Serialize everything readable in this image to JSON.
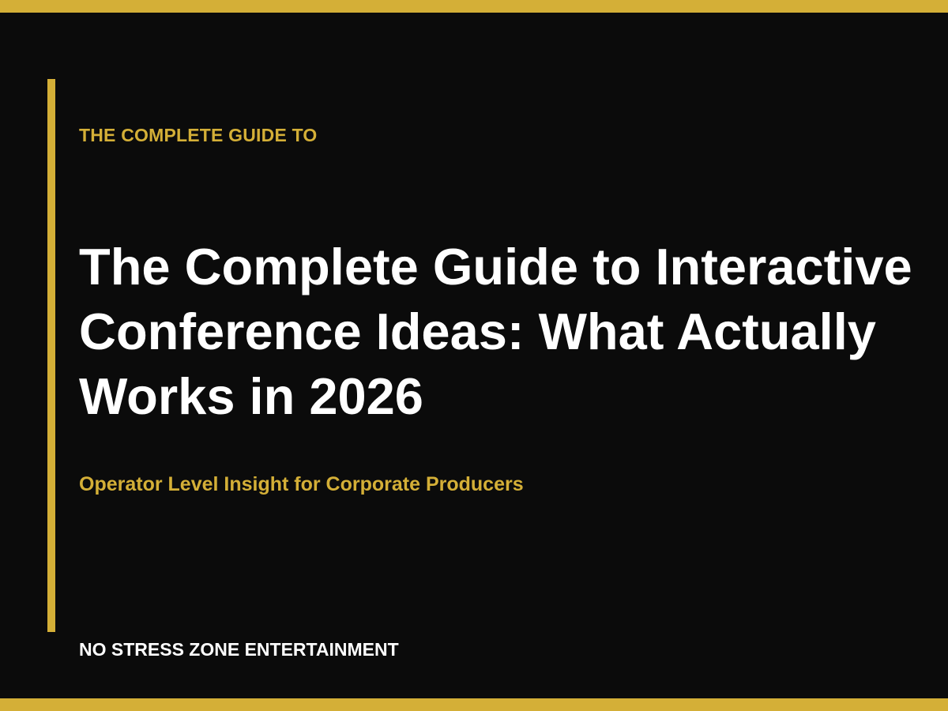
{
  "cover": {
    "eyebrow": "THE COMPLETE GUIDE TO",
    "title": "The Complete Guide to Interactive Conference Ideas: What Actually Works in 2026",
    "subtitle": "Operator Level Insight for Corporate Producers",
    "brand": "NO STRESS ZONE ENTERTAINMENT"
  },
  "colors": {
    "background": "#0b0b0b",
    "accent": "#d4af37",
    "title_text": "#ffffff"
  }
}
